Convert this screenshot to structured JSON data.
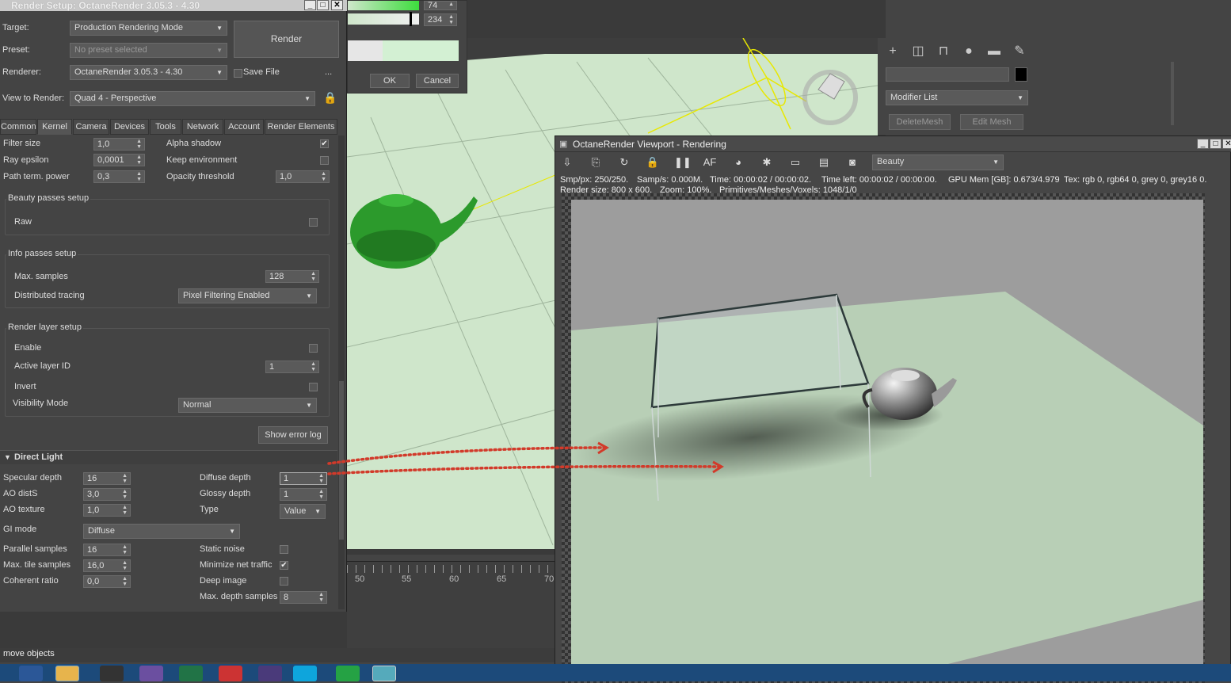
{
  "render_setup": {
    "title": "Render Setup: OctaneRender 3.05.3 - 4.30",
    "target_label": "Target:",
    "target_value": "Production Rendering Mode",
    "preset_label": "Preset:",
    "preset_value": "No preset selected",
    "renderer_label": "Renderer:",
    "renderer_value": "OctaneRender 3.05.3 - 4.30",
    "save_file_label": "Save File",
    "more_label": "...",
    "view_label": "View to Render:",
    "view_value": "Quad 4 - Perspective",
    "render_button": "Render",
    "tabs": [
      "Common",
      "Kernel",
      "Camera",
      "Devices",
      "Tools",
      "Network",
      "Account",
      "Render Elements"
    ],
    "kernel": {
      "filter_size_label": "Filter size",
      "filter_size_value": "1,0",
      "alpha_shadow_label": "Alpha shadow",
      "ray_epsilon_label": "Ray epsilon",
      "ray_epsilon_value": "0,0001",
      "keep_env_label": "Keep environment",
      "path_term_label": "Path term. power",
      "path_term_value": "0,3",
      "opacity_label": "Opacity threshold",
      "opacity_value": "1,0",
      "beauty_title": "Beauty passes setup",
      "raw_label": "Raw",
      "info_title": "Info passes setup",
      "max_samples_label": "Max. samples",
      "max_samples_value": "128",
      "dist_tracing_label": "Distributed tracing",
      "dist_tracing_value": "Pixel Filtering Enabled",
      "layer_title": "Render layer setup",
      "enable_label": "Enable",
      "active_layer_label": "Active layer ID",
      "active_layer_value": "1",
      "invert_label": "Invert",
      "visibility_label": "Visibility Mode",
      "visibility_value": "Normal",
      "show_error_log": "Show error log",
      "direct_light_title": "Direct Light",
      "specular_depth_label": "Specular depth",
      "specular_depth_value": "16",
      "diffuse_depth_label": "Diffuse depth",
      "diffuse_depth_value": "1",
      "ao_dist_label": "AO distS",
      "ao_dist_value": "3,0",
      "glossy_depth_label": "Glossy depth",
      "glossy_depth_value": "1",
      "ao_texture_label": "AO texture",
      "ao_texture_value": "1,0",
      "type_label": "Type",
      "type_value": "Value",
      "gi_mode_label": "GI mode",
      "gi_mode_value": "Diffuse",
      "parallel_label": "Parallel samples",
      "parallel_value": "16",
      "static_noise_label": "Static noise",
      "max_tile_label": "Max. tile samples",
      "max_tile_value": "16,0",
      "min_net_label": "Minimize net traffic",
      "coherent_label": "Coherent ratio",
      "coherent_value": "0,0",
      "deep_image_label": "Deep image",
      "max_depth_label": "Max. depth samples",
      "max_depth_value": "8"
    }
  },
  "color_dialog": {
    "value1": "74",
    "value2": "234",
    "ok": "OK",
    "cancel": "Cancel"
  },
  "command_panel": {
    "modifier_list": "Modifier List",
    "delete_mesh": "DeleteMesh",
    "edit_mesh": "Edit Mesh"
  },
  "timeline": {
    "ticks": [
      "50",
      "55",
      "60",
      "65",
      "70"
    ]
  },
  "octane": {
    "title": "OctaneRender Viewport - Rendering",
    "pass": "Beauty",
    "info1_a": "Smp/px: 250/250.",
    "info1_b": "Samp/s: 0.000M.",
    "info1_c": "Time: 00:00:02 / 00:00:02.",
    "info1_d": "Time left: 00:00:02 / 00:00:00.",
    "info1_e": "GPU Mem [GB]: 0.673/4.979",
    "info1_f": "Tex: rgb 0, rgb64 0, grey 0, grey16 0.",
    "info2_a": "Render size: 800 x 600.",
    "info2_b": "Zoom: 100%.",
    "info2_c": "Primitives/Meshes/Voxels: 1048/1/0"
  },
  "status_text": "move objects",
  "colors": {
    "accent_red": "#d23a2a",
    "teapot_green": "#2c9a2c",
    "ground_green": "#cfe6cb"
  }
}
